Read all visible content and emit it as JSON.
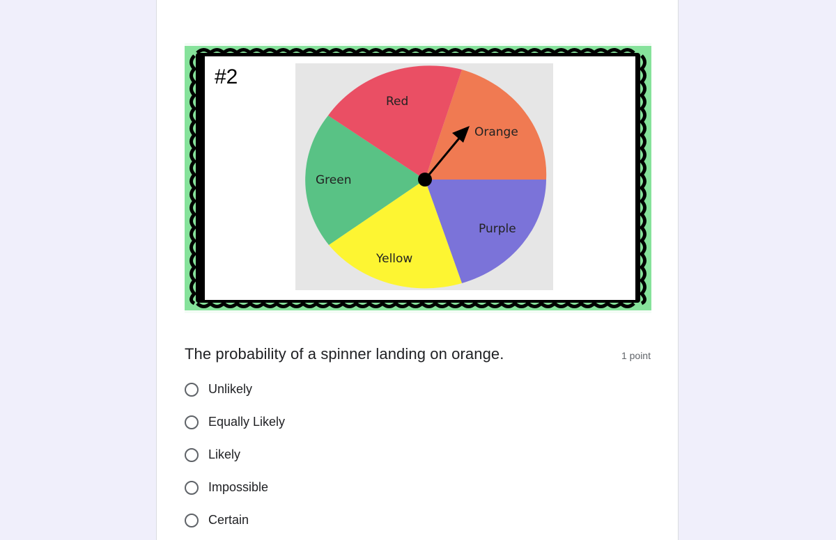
{
  "question": {
    "image": {
      "card_number": "#2",
      "spinner_labels": {
        "red": "Red",
        "orange": "Orange",
        "green": "Green",
        "purple": "Purple",
        "yellow": "Yellow"
      },
      "colors": {
        "frame_green": "#86e29b",
        "frame_black": "#000000",
        "red": "#ea4f64",
        "orange": "#f07a52",
        "green": "#59c285",
        "purple": "#7b73d9",
        "yellow": "#fdf532",
        "image_bg": "#e6e6e6"
      }
    },
    "title": "The probability of a spinner landing on orange.",
    "points": "1 point",
    "options": [
      {
        "label": "Unlikely"
      },
      {
        "label": "Equally Likely"
      },
      {
        "label": "Likely"
      },
      {
        "label": "Impossible"
      },
      {
        "label": "Certain"
      }
    ]
  }
}
